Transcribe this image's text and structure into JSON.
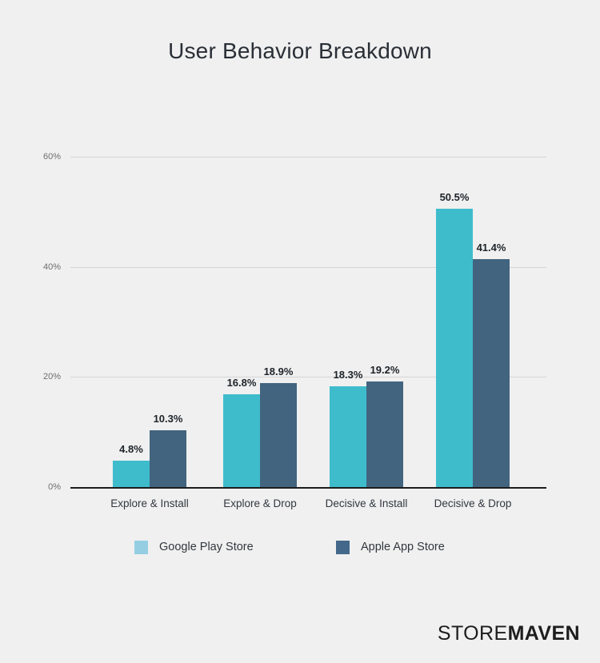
{
  "chart_data": {
    "type": "bar",
    "title": "User Behavior Breakdown",
    "xlabel": "",
    "ylabel": "",
    "ylim": [
      0,
      60
    ],
    "yticks": [
      "0%",
      "20%",
      "40%",
      "60%"
    ],
    "ytick_values": [
      0,
      20,
      40,
      60
    ],
    "grid": true,
    "legend_position": "bottom",
    "value_suffix": "%",
    "categories": [
      "Explore & Install",
      "Explore & Drop",
      "Decisive & Install",
      "Decisive & Drop"
    ],
    "series": [
      {
        "name": "Google Play Store",
        "color": "#3EBCCC",
        "legend_color": "#95CEE3",
        "values": [
          4.8,
          16.8,
          18.3,
          50.5
        ],
        "labels": [
          "4.8%",
          "16.8%",
          "18.3%",
          "50.5%"
        ]
      },
      {
        "name": "Apple App Store",
        "color": "#42647F",
        "legend_color": "#44688A",
        "values": [
          10.3,
          18.9,
          19.2,
          41.4
        ],
        "labels": [
          "10.3%",
          "18.9%",
          "19.2%",
          "41.4%"
        ]
      }
    ]
  },
  "colors": {
    "background": "#F0F0F0",
    "title_text": "#2A2F36",
    "gridline": "#D5D5D5",
    "axis": "#1C1C1C",
    "tick_text": "#6E6E6E",
    "label_text": "#1D2329",
    "google_bar": "#3EBCCC",
    "apple_bar": "#42647F",
    "google_legend": "#95CEE3",
    "apple_legend": "#44688A"
  },
  "footer": {
    "logo_part_one": "STORE",
    "logo_part_two": "MAVEN"
  }
}
